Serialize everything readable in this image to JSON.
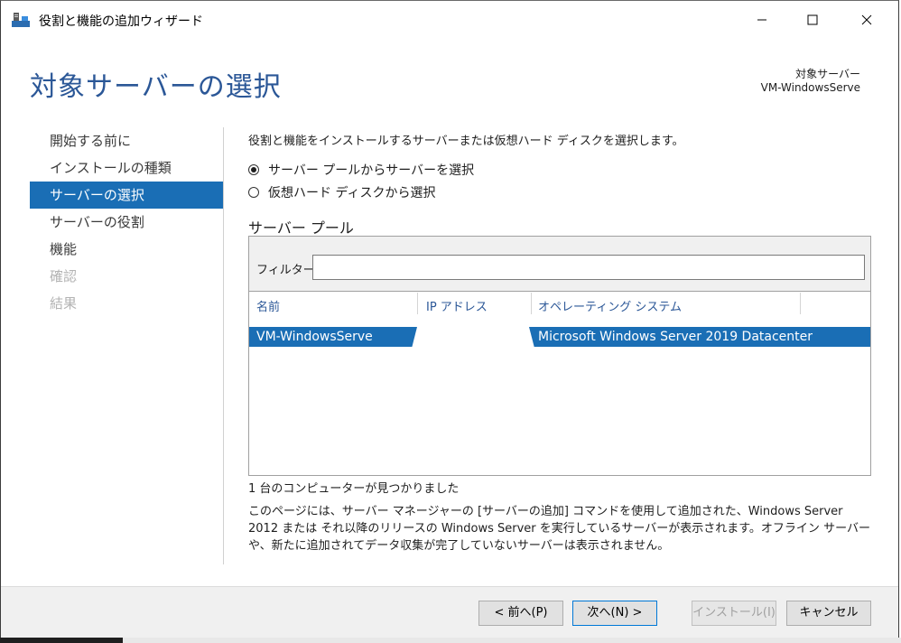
{
  "window": {
    "title": "役割と機能の追加ウィザード",
    "controls": {
      "minimize": "—",
      "maximize": "☐",
      "close": "✕"
    }
  },
  "header": {
    "page_title": "対象サーバーの選択",
    "dest_label": "対象サーバー",
    "dest_value": "VM-WindowsServe"
  },
  "nav": {
    "items": [
      {
        "label": "開始する前に",
        "state": "normal"
      },
      {
        "label": "インストールの種類",
        "state": "normal"
      },
      {
        "label": "サーバーの選択",
        "state": "active"
      },
      {
        "label": "サーバーの役割",
        "state": "normal"
      },
      {
        "label": "機能",
        "state": "normal"
      },
      {
        "label": "確認",
        "state": "disabled"
      },
      {
        "label": "結果",
        "state": "disabled"
      }
    ]
  },
  "main": {
    "description": "役割と機能をインストールするサーバーまたは仮想ハード ディスクを選択します。",
    "radio_pool": "サーバー プールからサーバーを選択",
    "radio_vhd": "仮想ハード ディスクから選択",
    "pool_title": "サーバー プール",
    "filter_label": "フィルター:",
    "filter_value": "",
    "columns": [
      "名前",
      "IP アドレス",
      "オペレーティング システム"
    ],
    "rows": [
      {
        "name": "VM-WindowsServe",
        "ip": "",
        "os": "Microsoft Windows Server 2019 Datacenter",
        "selected": true
      }
    ],
    "found_text": "1 台のコンピューターが見つかりました",
    "note_text": "このページには、サーバー マネージャーの [サーバーの追加] コマンドを使用して追加された、Windows Server 2012 または それ以降のリリースの Windows Server を実行しているサーバーが表示されます。オフライン サーバーや、新たに追加されてデータ収集が完了していないサーバーは表示されません。"
  },
  "footer": {
    "prev": "< 前へ(P)",
    "next": "次へ(N) >",
    "install": "インストール(I)",
    "cancel": "キャンセル"
  },
  "colors": {
    "accent": "#1a6eb5",
    "title_blue": "#2b5797",
    "footer_bg": "#f0f0f0"
  }
}
